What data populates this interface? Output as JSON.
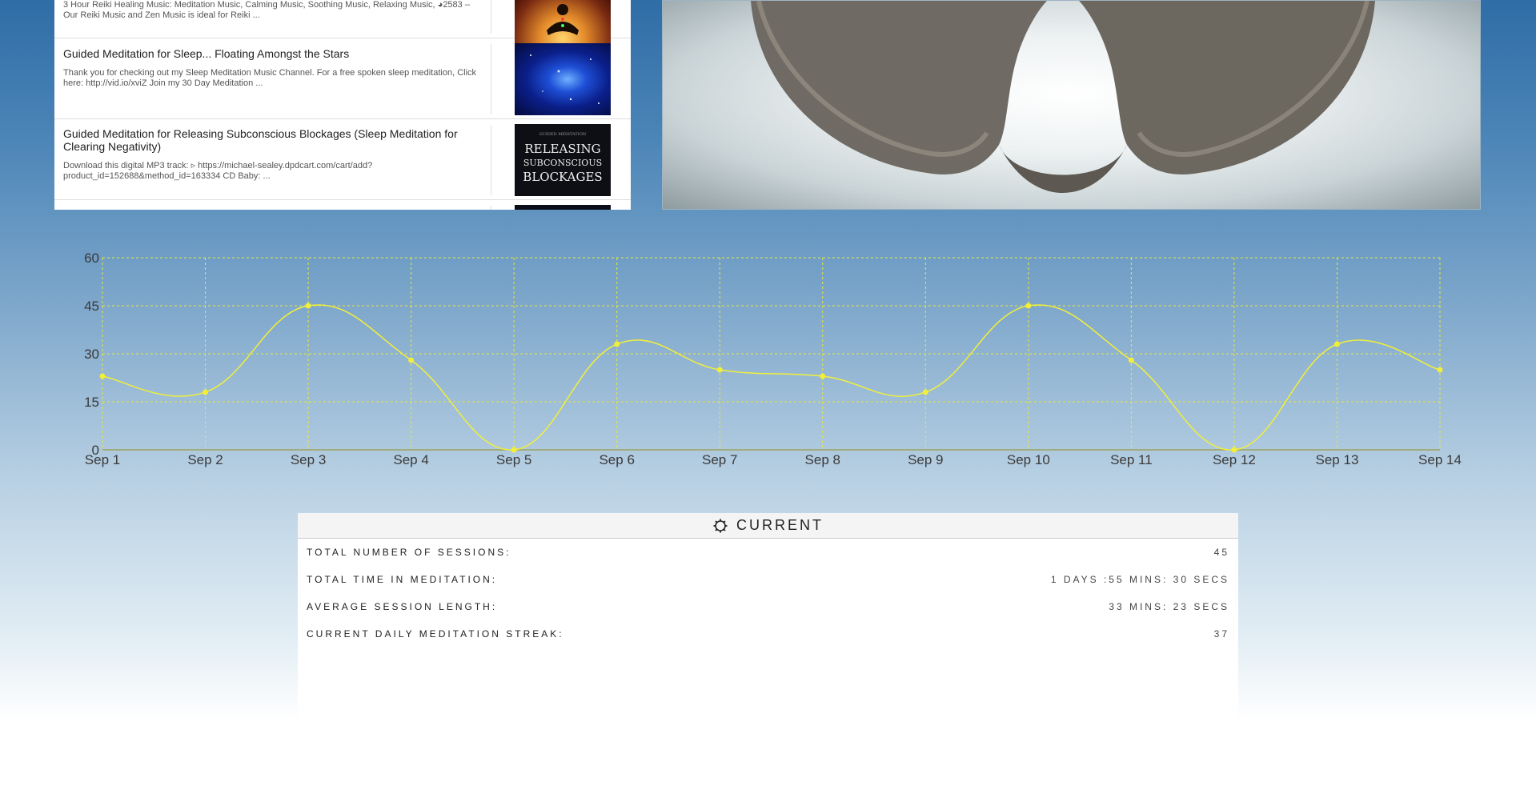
{
  "videos": [
    {
      "title": "",
      "description": "3 Hour Reiki Healing Music: Meditation Music, Calming Music, Soothing Music, Relaxing Music, ◕2583 – Our Reiki Music and Zen Music is ideal for Reiki ...",
      "thumbnail_icon": "meditation-chakra-image"
    },
    {
      "title": "Guided Meditation for Sleep... Floating Amongst the Stars",
      "description": "Thank you for checking out my Sleep Meditation Music Channel. For a free spoken sleep meditation, Click here: http://vid.io/xviZ Join my 30 Day Meditation ...",
      "thumbnail_icon": "starry-galaxy-image"
    },
    {
      "title": "Guided Meditation for Releasing Subconscious Blockages (Sleep Meditation for Clearing Negativity)",
      "description": "Download this digital MP3 track: ▹ https://michael-sealey.dpdcart.com/cart/add?product_id=152688&method_id=163334 CD Baby: ...",
      "thumbnail_icon": "releasing-blockages-image",
      "thumbnail_text": {
        "top": "GUIDED MEDITATION",
        "line1": "RELEASING",
        "line2": "SUBCONSCIOUS",
        "line3": "BLOCKAGES"
      }
    }
  ],
  "photo": {
    "icon": "cupped-hands-photo"
  },
  "chart_data": {
    "type": "line",
    "categories": [
      "Sep 1",
      "Sep 2",
      "Sep 3",
      "Sep 4",
      "Sep 5",
      "Sep 6",
      "Sep 7",
      "Sep 8",
      "Sep 9",
      "Sep 10",
      "Sep 11",
      "Sep 12",
      "Sep 13",
      "Sep 14"
    ],
    "series": [
      {
        "values": [
          23,
          18,
          45,
          28,
          0,
          33,
          25,
          23,
          18,
          45,
          28,
          0,
          33,
          25
        ]
      }
    ],
    "yticks": [
      0,
      15,
      30,
      45,
      60
    ],
    "ylim": [
      0,
      60
    ],
    "grid": true,
    "line_color": "#f2ef3a",
    "grid_color": "#e8e83a"
  },
  "stats": {
    "header": "CURRENT",
    "header_icon": "gear-icon",
    "rows": [
      {
        "label": "TOTAL NUMBER OF SESSIONS:",
        "value": "45"
      },
      {
        "label": "TOTAL TIME IN MEDITATION:",
        "value": "1 DAYS :55 MINS: 30 SECS"
      },
      {
        "label": "AVERAGE SESSION LENGTH:",
        "value": "33 MINS: 23 SECS"
      },
      {
        "label": "CURRENT DAILY MEDITATION STREAK:",
        "value": "37"
      }
    ]
  }
}
